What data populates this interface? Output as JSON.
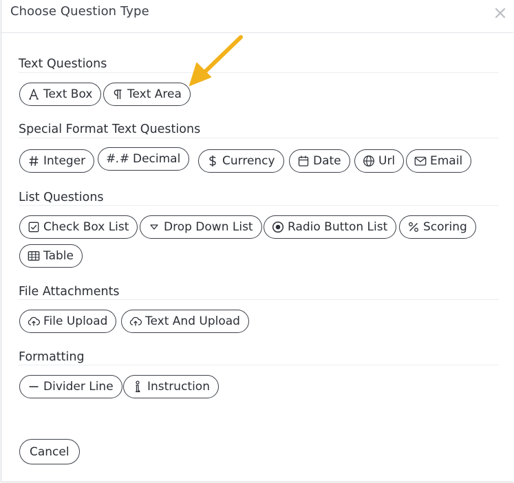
{
  "dialog": {
    "title": "Choose Question Type",
    "close_icon": "close-icon"
  },
  "sections": {
    "text": {
      "title": "Text Questions",
      "buttons": {
        "text_box": {
          "label": "Text Box",
          "icon": "text-box-icon"
        },
        "text_area": {
          "label": "Text Area",
          "icon": "pilcrow-icon"
        }
      }
    },
    "special": {
      "title": "Special Format Text Questions",
      "buttons": {
        "integer": {
          "label": "Integer",
          "icon": "hash-icon"
        },
        "decimal": {
          "label": "Decimal",
          "icon_text": "#.#"
        },
        "currency": {
          "label": "Currency",
          "icon": "dollar-icon"
        },
        "date": {
          "label": "Date",
          "icon": "calendar-icon"
        },
        "url": {
          "label": "Url",
          "icon": "globe-icon"
        },
        "email": {
          "label": "Email",
          "icon": "envelope-icon"
        }
      }
    },
    "list": {
      "title": "List Questions",
      "buttons": {
        "check_box_list": {
          "label": "Check Box List",
          "icon": "checkbox-icon"
        },
        "drop_down_list": {
          "label": "Drop Down List",
          "icon": "triangle-down-icon"
        },
        "radio_button_list": {
          "label": "Radio Button List",
          "icon": "radio-icon"
        },
        "scoring": {
          "label": "Scoring",
          "icon": "percent-icon"
        },
        "table": {
          "label": "Table",
          "icon": "table-icon"
        }
      }
    },
    "files": {
      "title": "File Attachments",
      "buttons": {
        "file_upload": {
          "label": "File Upload",
          "icon": "cloud-upload-icon"
        },
        "text_and_upload": {
          "label": "Text And Upload",
          "icon": "cloud-upload-icon"
        }
      }
    },
    "formatting": {
      "title": "Formatting",
      "buttons": {
        "divider_line": {
          "label": "Divider Line",
          "icon": "minus-icon"
        },
        "instruction": {
          "label": "Instruction",
          "icon": "info-icon"
        }
      }
    }
  },
  "footer": {
    "cancel_label": "Cancel"
  },
  "colors": {
    "border": "#3b4048",
    "text": "#2b2f36",
    "annotation_arrow": "#f2b21b"
  }
}
